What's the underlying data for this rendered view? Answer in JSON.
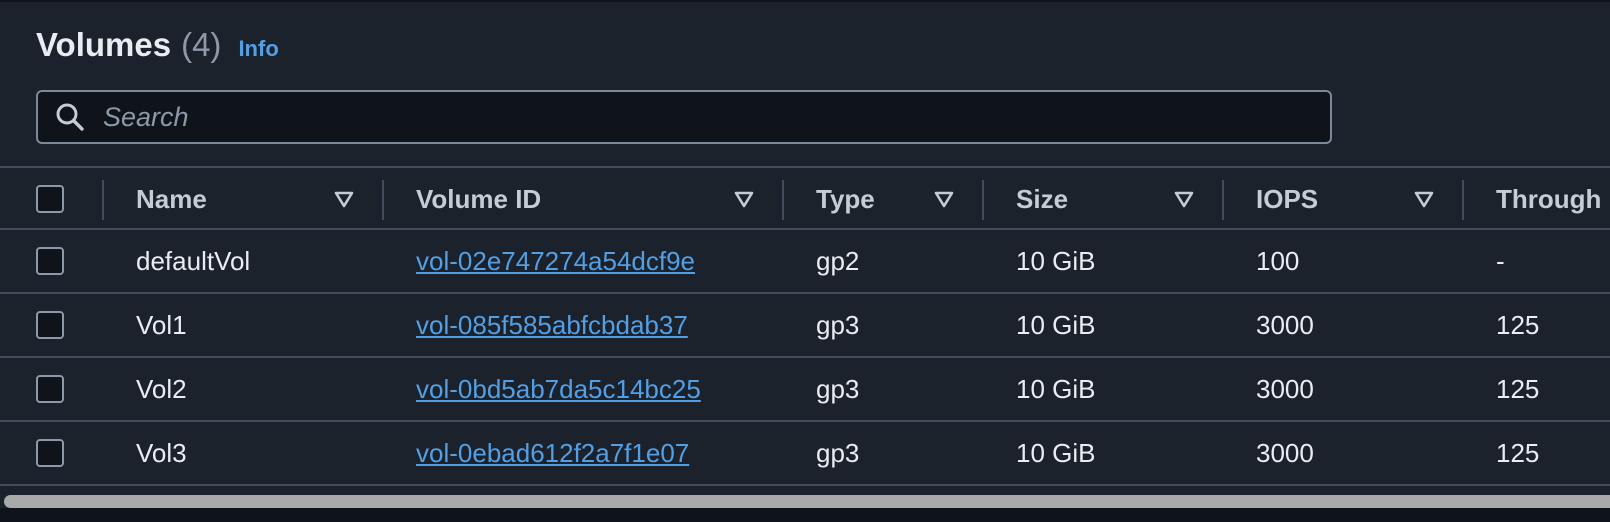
{
  "header": {
    "title": "Volumes",
    "count": "(4)",
    "info_label": "Info"
  },
  "search": {
    "placeholder": "Search",
    "value": ""
  },
  "columns": {
    "name": "Name",
    "volume_id": "Volume ID",
    "type": "Type",
    "size": "Size",
    "iops": "IOPS",
    "throughput": "Through"
  },
  "rows": [
    {
      "name": "defaultVol",
      "volume_id": "vol-02e747274a54dcf9e",
      "type": "gp2",
      "size": "10 GiB",
      "iops": "100",
      "throughput": "-"
    },
    {
      "name": "Vol1",
      "volume_id": "vol-085f585abfcbdab37",
      "type": "gp3",
      "size": "10 GiB",
      "iops": "3000",
      "throughput": "125"
    },
    {
      "name": "Vol2",
      "volume_id": "vol-0bd5ab7da5c14bc25",
      "type": "gp3",
      "size": "10 GiB",
      "iops": "3000",
      "throughput": "125"
    },
    {
      "name": "Vol3",
      "volume_id": "vol-0ebad612f2a7f1e07",
      "type": "gp3",
      "size": "10 GiB",
      "iops": "3000",
      "throughput": "125"
    }
  ],
  "icons": {
    "search": "search-icon",
    "sort": "caret-down-outline-icon"
  },
  "colors": {
    "background": "#1b222c",
    "link": "#539fe5",
    "text": "#e9edf2",
    "muted": "#8d99a8",
    "border": "#414d5c"
  }
}
